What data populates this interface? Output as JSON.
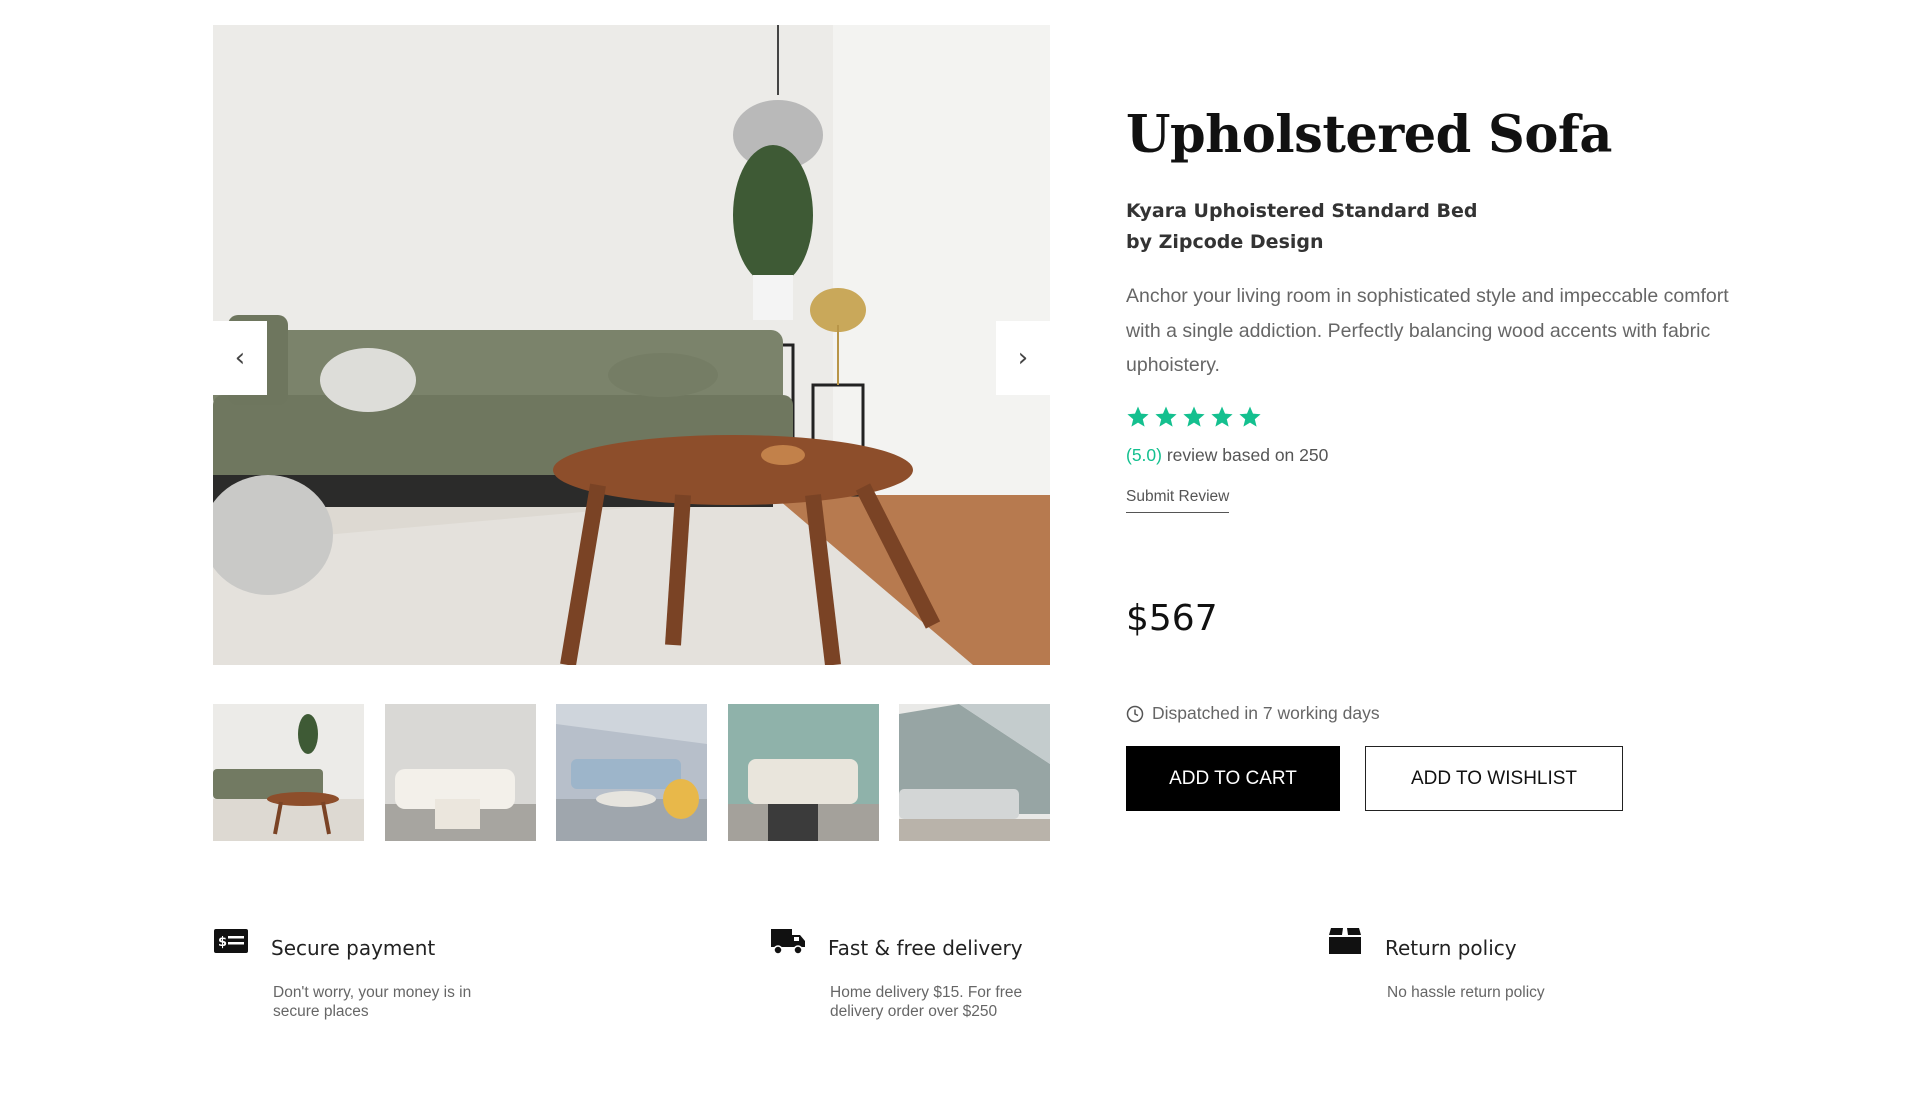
{
  "gallery": {
    "prev_label": "‹",
    "next_label": "›",
    "thumbnails": [
      "thumb-1",
      "thumb-2",
      "thumb-3",
      "thumb-4",
      "thumb-5"
    ]
  },
  "product": {
    "title": "Upholstered Sofa",
    "subtitle_line1": "Kyara Uphoistered Standard Bed",
    "subtitle_line2": "by Zipcode Design",
    "description": "Anchor your living room in sophisticated style and impeccable comfort with a single addiction. Perfectly balancing wood accents with fabric uphoistery.",
    "rating": 5,
    "rating_text": "(5.0)",
    "review_text": " review based on 250",
    "submit_review": "Submit Review",
    "price": "$567",
    "dispatch": "Dispatched in 7 working days",
    "add_to_cart": "ADD TO CART",
    "add_to_wishlist": "ADD TO WISHLIST"
  },
  "features": [
    {
      "icon": "payment-card-icon",
      "title": "Secure payment",
      "text": "Don't worry, your money is in secure places"
    },
    {
      "icon": "truck-icon",
      "title": "Fast & free delivery",
      "text": "Home delivery $15. For free delivery order over $250"
    },
    {
      "icon": "box-icon",
      "title": "Return policy",
      "text": "No hassle return policy"
    }
  ],
  "colors": {
    "accent": "#14c08f",
    "button_dark": "#000000"
  }
}
